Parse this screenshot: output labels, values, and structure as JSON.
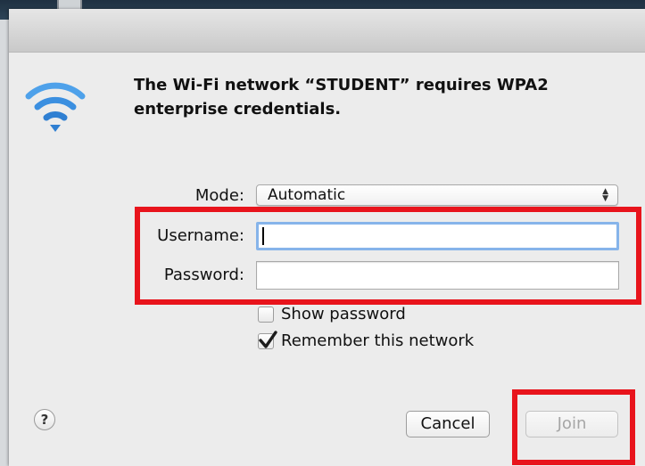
{
  "dialog": {
    "message": "The Wi‑Fi network “STUDENT” requires WPA2 enterprise credentials."
  },
  "form": {
    "mode_label": "Mode:",
    "mode_value": "Automatic",
    "username_label": "Username:",
    "username_value": "",
    "password_label": "Password:",
    "password_value": ""
  },
  "options": {
    "show_password_label": "Show password",
    "show_password_checked": false,
    "remember_label": "Remember this network",
    "remember_checked": true
  },
  "buttons": {
    "help": "?",
    "cancel": "Cancel",
    "join": "Join"
  },
  "colors": {
    "wifi_blue": "#3b8fe0",
    "highlight_red": "#e8141c",
    "focus_ring": "#86b4ea"
  }
}
